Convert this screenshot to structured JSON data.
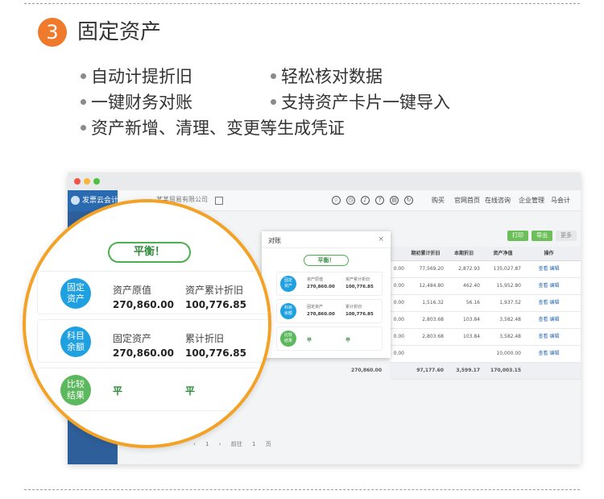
{
  "section": {
    "step_number": "3",
    "title": "固定资产"
  },
  "features": [
    "自动计提折旧",
    "轻松核对数据",
    "一键财务对账",
    "支持资产卡片一键导入",
    "资产新增、清理、变更等生成凭证"
  ],
  "app": {
    "brand": "发票云会计",
    "company_selector": "某某贸易有限公司",
    "header_links": [
      "购买",
      "官网首页",
      "在线咨询",
      "企业管理",
      "马会计"
    ],
    "content_buttons": [
      "打印",
      "导出",
      "更多"
    ],
    "table": {
      "columns": [
        "期初累计折旧",
        "本期折旧",
        "资产净值",
        "操作"
      ],
      "rows": [
        {
          "lead": "0.00",
          "cum": "77,569.20",
          "cur": "2,872.93",
          "net": "135,027.87",
          "op": "查看 编辑"
        },
        {
          "lead": "0.00",
          "cum": "12,484.80",
          "cur": "462.40",
          "net": "15,952.80",
          "op": "查看 编辑"
        },
        {
          "lead": "0.00",
          "cum": "1,516.32",
          "cur": "56.16",
          "net": "1,937.52",
          "op": "查看 编辑"
        },
        {
          "lead": "0.00",
          "cum": "2,803.68",
          "cur": "103.84",
          "net": "3,582.48",
          "op": "查看 编辑"
        },
        {
          "lead": "0.00",
          "cum": "2,803.68",
          "cur": "103.84",
          "net": "3,582.48",
          "op": "查看 编辑"
        },
        {
          "lead": "0.00",
          "cum": "",
          "cur": "",
          "net": "10,000.00",
          "op": "查看 编辑"
        }
      ],
      "total": {
        "orig": "270,860.00",
        "cum": "97,177.60",
        "cur": "3,599.17",
        "net": "170,003.15"
      }
    },
    "pagination": {
      "prev": "‹",
      "page": "1",
      "next": "›",
      "goto": "前往",
      "page_input": "1",
      "page_suffix": "页"
    }
  },
  "reconcile": {
    "dialog_title": "对账",
    "close_symbol": "×",
    "balanced": "平衡！",
    "fixed_assets": {
      "badge": "固定\n资产",
      "label1": "资产原值",
      "label2": "资产累计折旧",
      "value1": "270,860.00",
      "value2": "100,776.85"
    },
    "subject_balance": {
      "badge": "科目\n余额",
      "label1": "固定资产",
      "label2": "累计折旧",
      "value1": "270,860.00",
      "value2": "100,776.85"
    },
    "compare": {
      "badge": "比较\n结果",
      "result1": "平",
      "result2": "平"
    }
  },
  "colors": {
    "accent_orange": "#f07a2c",
    "magnifier_ring": "#f3a226",
    "badge_blue": "#1fa0e0",
    "badge_green": "#5cb85c",
    "balance_green": "#2e8b3a",
    "sidebar_blue": "#2e5f9a"
  }
}
